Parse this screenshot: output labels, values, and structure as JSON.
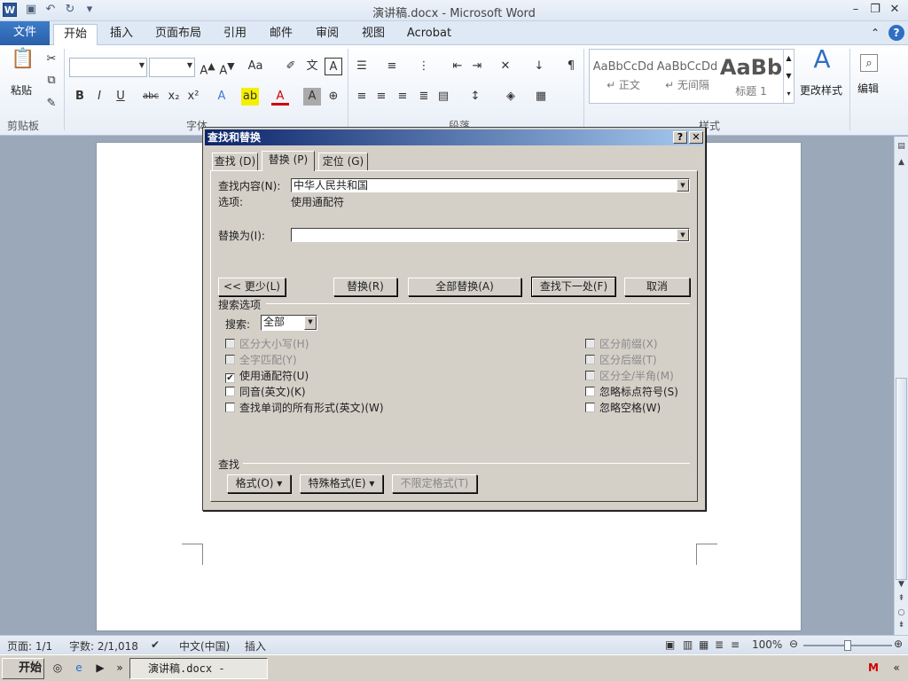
{
  "window": {
    "title": "演讲稿.docx - Microsoft Word",
    "app_icon": "W"
  },
  "ribbon_tabs": [
    "文件",
    "开始",
    "插入",
    "页面布局",
    "引用",
    "邮件",
    "审阅",
    "视图",
    "Acrobat"
  ],
  "ribbon": {
    "clipboard": {
      "paste_label": "粘贴",
      "group_label": "剪贴板"
    },
    "font": {
      "group_label": "字体"
    },
    "paragraph": {
      "group_label": "段落"
    },
    "styles": {
      "group_label": "样式",
      "items": [
        {
          "sample": "AaBbCcDd",
          "name": "↵ 正文"
        },
        {
          "sample": "AaBbCcDd",
          "name": "↵ 无间隔"
        },
        {
          "sample": "AaBb",
          "name": "标题 1"
        }
      ],
      "change_styles_label": "更改样式"
    },
    "editing": {
      "label": "编辑"
    }
  },
  "dialog": {
    "title": "查找和替换",
    "tabs": [
      "查找 (D)",
      "替换 (P)",
      "定位 (G)"
    ],
    "find_label": "查找内容(N):",
    "find_value": "中华人民共和国",
    "options_label": "选项:",
    "options_value": "使用通配符",
    "replace_label": "替换为(I):",
    "replace_value": "",
    "buttons": {
      "less": "<< 更少(L)",
      "replace": "替换(R)",
      "replace_all": "全部替换(A)",
      "find_next": "查找下一处(F)",
      "cancel": "取消"
    },
    "search_options_label": "搜索选项",
    "search_label": "搜索:",
    "search_value": "全部",
    "checkboxes_left": [
      {
        "label": "区分大小写(H)",
        "checked": false,
        "disabled": true
      },
      {
        "label": "全字匹配(Y)",
        "checked": false,
        "disabled": true
      },
      {
        "label": "使用通配符(U)",
        "checked": true,
        "disabled": false
      },
      {
        "label": "同音(英文)(K)",
        "checked": false,
        "disabled": false
      },
      {
        "label": "查找单词的所有形式(英文)(W)",
        "checked": false,
        "disabled": false
      }
    ],
    "checkboxes_right": [
      {
        "label": "区分前缀(X)",
        "checked": false,
        "disabled": true
      },
      {
        "label": "区分后缀(T)",
        "checked": false,
        "disabled": true
      },
      {
        "label": "区分全/半角(M)",
        "checked": false,
        "disabled": true
      },
      {
        "label": "忽略标点符号(S)",
        "checked": false,
        "disabled": false
      },
      {
        "label": "忽略空格(W)",
        "checked": false,
        "disabled": false
      }
    ],
    "find_section_label": "查找",
    "format_button": "格式(O) ▾",
    "special_button": "特殊格式(E) ▾",
    "no_format_button": "不限定格式(T)"
  },
  "statusbar": {
    "page": "页面: 1/1",
    "words": "字数: 2/1,018",
    "language": "中文(中国)",
    "mode": "插入",
    "zoom": "100%"
  },
  "taskbar": {
    "start_label": "开始",
    "task_label": "演讲稿.docx - Micro..."
  }
}
